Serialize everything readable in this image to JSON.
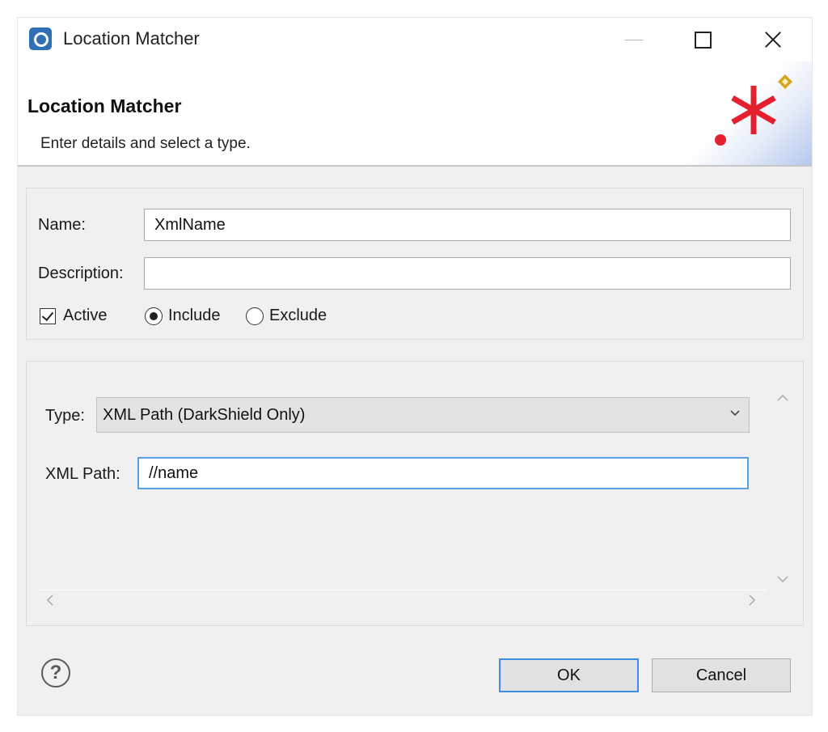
{
  "window": {
    "title": "Location Matcher"
  },
  "header": {
    "title": "Location Matcher",
    "subtitle": "Enter details and select a type."
  },
  "form": {
    "name_label": "Name:",
    "name_value": "XmlName",
    "description_label": "Description:",
    "description_value": "",
    "active_label": "Active",
    "active_checked": true,
    "include_label": "Include",
    "exclude_label": "Exclude",
    "selected_mode": "Include"
  },
  "details": {
    "type_label": "Type:",
    "type_value": "XML Path (DarkShield Only)",
    "xml_path_label": "XML Path:",
    "xml_path_value": "//name"
  },
  "buttons": {
    "ok": "OK",
    "cancel": "Cancel",
    "help": "?"
  },
  "colors": {
    "accent_red": "#e5202e",
    "focus_blue": "#5aa0e6",
    "diamond": "#d8a520"
  }
}
